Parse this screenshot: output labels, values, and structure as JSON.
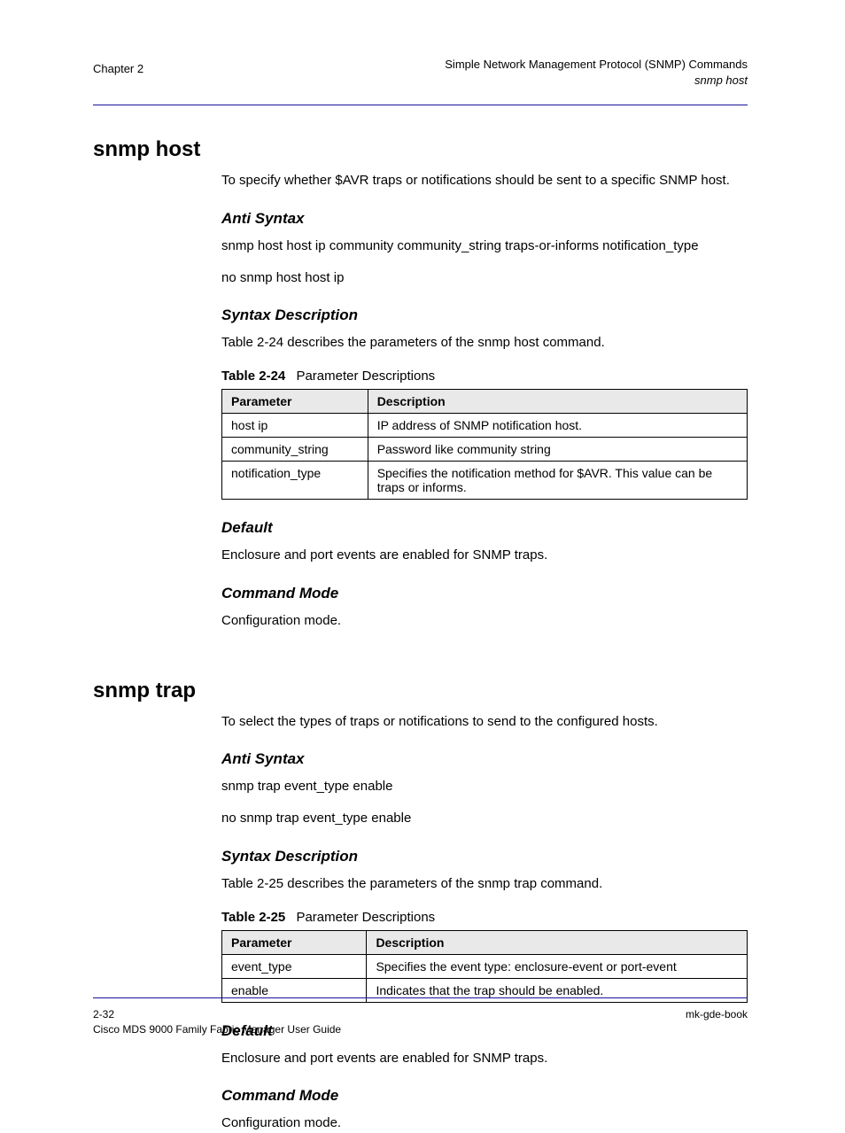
{
  "header": {
    "chapter": "Chapter 2",
    "right_line1": "Simple Network Management Protocol (SNMP) Commands",
    "right_line2": "snmp host"
  },
  "section1": {
    "title": "snmp host",
    "p1": "To specify whether $AVR traps or notifications should be sent to a specific SNMP host.",
    "h_antisyntax": "Anti Syntax",
    "p2_prefix": "snmp ",
    "p2_rest": "host host ip community community_string traps-or-informs notification_type",
    "p3_prefix": "no snmp ",
    "p3_rest": "host host ip",
    "h_syntax": "Syntax Description",
    "t_caption_num": "Table 2-24",
    "t_caption": "describes the parameters of the snmp host command.",
    "t_label_num": "Table 2-24",
    "t_label": "Parameter Descriptions",
    "table": {
      "headers": [
        "Parameter",
        "Description"
      ],
      "rows": [
        [
          "host ip",
          "IP address of SNMP notification host."
        ],
        [
          "community_string",
          "Password like community string"
        ],
        [
          "notification_type",
          "Specifies the notification method for $AVR. This value can be traps or informs."
        ]
      ]
    },
    "h_default": "Default",
    "p_default": "Enclosure and port events are enabled for SNMP traps.",
    "h_mode": "Command Mode",
    "p_mode": "Configuration mode."
  },
  "section2": {
    "title": "snmp trap",
    "p1": "To select the types of traps or notifications to send to the configured hosts.",
    "h_antisyntax": "Anti Syntax",
    "p2_prefix": "snmp ",
    "p2_rest": "trap event_type enable",
    "p3_prefix": "no snmp ",
    "p3_rest": "trap event_type enable",
    "h_syntax": "Syntax Description",
    "t_caption_num": "Table 2-25",
    "t_caption": "describes the parameters of the snmp trap command.",
    "t_label_num": "Table 2-25",
    "t_label": "Parameter Descriptions",
    "table": {
      "headers": [
        "Parameter",
        "Description"
      ],
      "rows": [
        [
          "event_type",
          "Specifies the event type: enclosure-event or port-event"
        ],
        [
          "enable",
          "Indicates that the trap should be enabled."
        ]
      ]
    },
    "h_default": "Default",
    "p_default": "Enclosure and port events are enabled for SNMP traps.",
    "h_mode": "Command Mode",
    "p_mode": "Configuration mode."
  },
  "footer": {
    "page": "2-32",
    "doc": "Cisco MDS 9000 Family Fabric Manager User Guide",
    "brand": "mk-gde-book"
  }
}
